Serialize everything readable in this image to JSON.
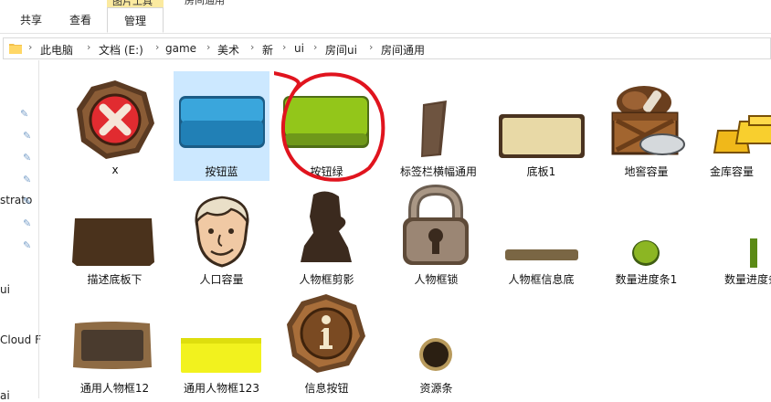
{
  "ribbon": {
    "context_label": "图片工具",
    "title_fragment": "房间通用",
    "tabs": [
      "共享",
      "查看",
      "管理"
    ]
  },
  "address": {
    "crumbs": [
      "此电脑",
      "文档 (E:)",
      "game",
      "美术",
      "新",
      "ui",
      "房间ui",
      "房间通用"
    ]
  },
  "nav": {
    "items": [
      "strato",
      "ui",
      "Cloud F",
      "ai"
    ]
  },
  "files": [
    {
      "name": "x"
    },
    {
      "name": "按钮蓝"
    },
    {
      "name": "按钮绿"
    },
    {
      "name": "标签栏横幅通用"
    },
    {
      "name": "底板1"
    },
    {
      "name": "地窖容量"
    },
    {
      "name": "金库容量"
    },
    {
      "name": "描述底板下"
    },
    {
      "name": "人口容量"
    },
    {
      "name": "人物框剪影"
    },
    {
      "name": "人物框锁"
    },
    {
      "name": "人物框信息底"
    },
    {
      "name": "数量进度条1"
    },
    {
      "name": "数量进度条"
    },
    {
      "name": "通用人物框12"
    },
    {
      "name": "通用人物框123"
    },
    {
      "name": "信息按钮"
    },
    {
      "name": "资源条"
    }
  ],
  "colors": {
    "selection": "#cce8ff",
    "annotation": "#e0141e",
    "button_blue": "#2a8cc4",
    "button_green": "#93c61a"
  }
}
